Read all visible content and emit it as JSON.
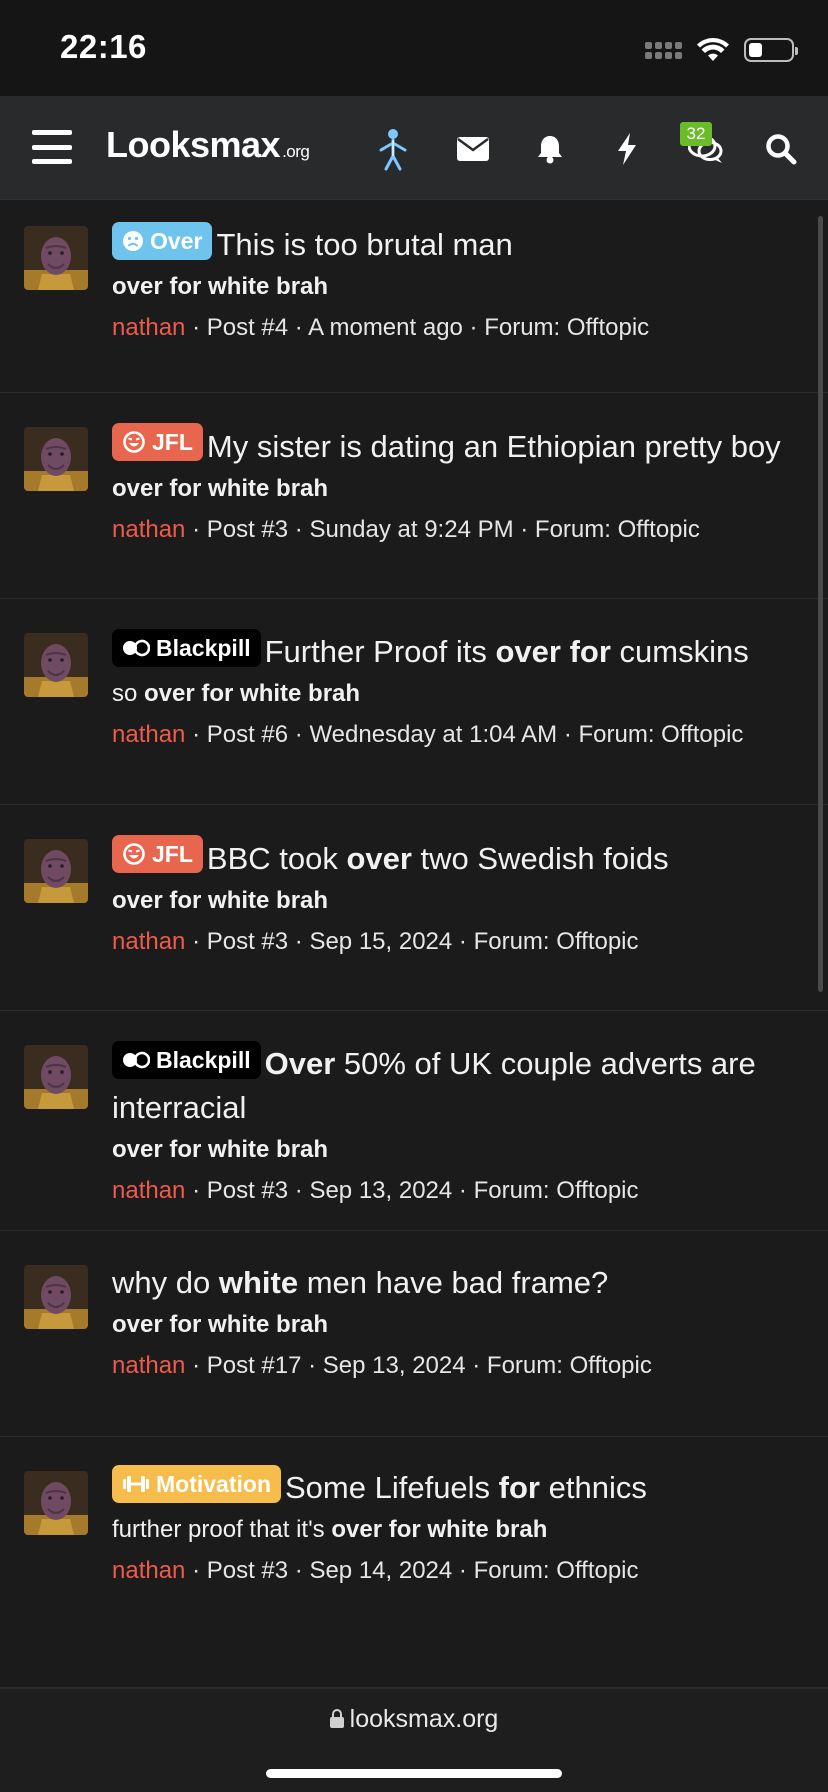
{
  "status_bar": {
    "time": "22:16",
    "battery_level": 0.3
  },
  "navbar": {
    "logo": "Looksmax",
    "logo_tld": ".org",
    "conversations_count": "32",
    "icons": [
      "menu-icon",
      "avatar-figure-icon",
      "envelope-icon",
      "bell-icon",
      "bolt-icon",
      "chat-icon",
      "search-icon"
    ]
  },
  "posts": [
    {
      "prefix": {
        "label": "Over",
        "icon": "sad-face-icon",
        "bg": "#6fc4ee",
        "fg": "#ffffff"
      },
      "title_parts": [
        {
          "t": "This is too brutal man",
          "b": false
        }
      ],
      "snippet_parts": [
        {
          "t": "over for white brah",
          "b": true
        }
      ],
      "author": "nathan",
      "meta": " · Post #4 · A moment ago · Forum: Offtopic"
    },
    {
      "prefix": {
        "label": "JFL",
        "icon": "laugh-icon",
        "bg": "#e8664d",
        "fg": "#ffffff"
      },
      "title_parts": [
        {
          "t": "My sister is dating an Ethiopian pretty boy",
          "b": false
        }
      ],
      "snippet_parts": [
        {
          "t": "over for white brah",
          "b": true
        }
      ],
      "author": "nathan",
      "meta": " · Post #3 · Sunday at 9:24 PM · Forum: Offtopic"
    },
    {
      "prefix": {
        "label": "Blackpill",
        "icon": "pill-icon",
        "bg": "#000000",
        "fg": "#ffffff"
      },
      "title_parts": [
        {
          "t": "Further Proof its ",
          "b": false
        },
        {
          "t": "over for",
          "b": true
        },
        {
          "t": " cumskins",
          "b": false
        }
      ],
      "snippet_parts": [
        {
          "t": "so ",
          "b": false
        },
        {
          "t": "over for white brah",
          "b": true
        }
      ],
      "author": "nathan",
      "meta": " · Post #6 · Wednesday at 1:04 AM · Forum: Offtopic"
    },
    {
      "prefix": {
        "label": "JFL",
        "icon": "laugh-icon",
        "bg": "#e8664d",
        "fg": "#ffffff"
      },
      "title_parts": [
        {
          "t": "BBC took ",
          "b": false
        },
        {
          "t": "over",
          "b": true
        },
        {
          "t": " two Swedish foids",
          "b": false
        }
      ],
      "snippet_parts": [
        {
          "t": "over for white brah",
          "b": true
        }
      ],
      "author": "nathan",
      "meta": " · Post #3 · Sep 15, 2024 · Forum: Offtopic"
    },
    {
      "prefix": {
        "label": "Blackpill",
        "icon": "pill-icon",
        "bg": "#000000",
        "fg": "#ffffff"
      },
      "title_parts": [
        {
          "t": "Over",
          "b": true
        },
        {
          "t": " 50% of UK couple adverts are interracial",
          "b": false
        }
      ],
      "snippet_parts": [
        {
          "t": "over for white brah",
          "b": true
        }
      ],
      "author": "nathan",
      "meta": " · Post #3 · Sep 13, 2024 · Forum: Offtopic"
    },
    {
      "prefix": null,
      "title_parts": [
        {
          "t": "why do ",
          "b": false
        },
        {
          "t": "white",
          "b": true
        },
        {
          "t": " men have bad frame?",
          "b": false
        }
      ],
      "snippet_parts": [
        {
          "t": "over for white brah",
          "b": true
        }
      ],
      "author": "nathan",
      "meta": " · Post #17 · Sep 13, 2024 · Forum: Offtopic"
    },
    {
      "prefix": {
        "label": "Motivation",
        "icon": "dumbbell-icon",
        "bg": "#f6bd4c",
        "fg": "#ffffff"
      },
      "title_parts": [
        {
          "t": "Some Lifefuels ",
          "b": false
        },
        {
          "t": "for",
          "b": true
        },
        {
          "t": " ethnics",
          "b": false
        }
      ],
      "snippet_parts": [
        {
          "t": "further proof that it's ",
          "b": false
        },
        {
          "t": "over for white brah",
          "b": true
        }
      ],
      "author": "nathan",
      "meta": " · Post #3 · Sep 14, 2024 · Forum: Offtopic"
    }
  ],
  "urlbar": {
    "lock_icon": "lock-icon",
    "url": "looksmax.org"
  }
}
